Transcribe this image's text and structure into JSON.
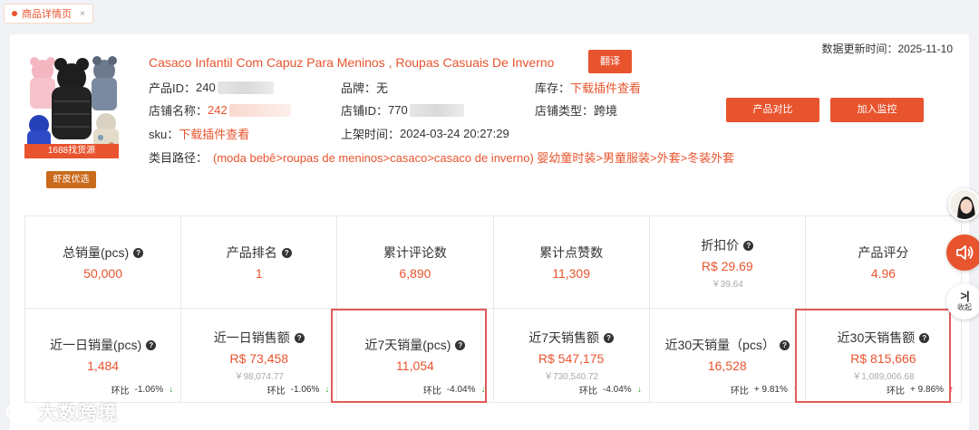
{
  "tab": {
    "label": "商品详情页",
    "close": "×"
  },
  "update_time": "数据更新时间：2025-11-10",
  "product": {
    "title": "Casaco Infantil Com Capuz Para Meninos , Roupas Casuais De Inverno",
    "translate_label": "翻译",
    "badge_1688": "1688找货源",
    "badge_shopee": "虾皮优选",
    "product_id_label": "产品ID：",
    "product_id_value": "240",
    "brand_label": "品牌：",
    "brand_value": "无",
    "stock_label": "库存：",
    "stock_value": "下载插件查看",
    "shop_name_label": "店铺名称：",
    "shop_name_value": "242",
    "shop_id_label": "店铺ID：",
    "shop_id_value": "770",
    "shop_type_label": "店铺类型：",
    "shop_type_value": "跨境",
    "sku_label": "sku：",
    "sku_value": "下载插件查看",
    "listed_label": "上架时间：",
    "listed_value": "2024-03-24 20:27:29",
    "category_label": "类目路径：",
    "category_value": "(moda bebê>roupas de meninos>casaco>casaco de inverno) 婴幼童时装>男童服装>外套>冬装外套"
  },
  "actions": {
    "compare_label": "产品对比",
    "monitor_label": "加入监控"
  },
  "stats_row1": [
    {
      "label": "总销量(pcs)",
      "help": true,
      "value": "50,000"
    },
    {
      "label": "产品排名",
      "help": true,
      "value": "1"
    },
    {
      "label": "累计评论数",
      "help": false,
      "value": "6,890"
    },
    {
      "label": "累计点赞数",
      "help": false,
      "value": "11,309"
    },
    {
      "label": "折扣价",
      "help": true,
      "value": "R$ 29.69",
      "sub": "￥39.64"
    },
    {
      "label": "产品评分",
      "help": false,
      "value": "4.96"
    }
  ],
  "stats_row2": [
    {
      "label": "近一日销量(pcs)",
      "value": "1,484",
      "ring_label": "环比",
      "ring_value": "-1.06%",
      "trend": "down"
    },
    {
      "label": "近一日销售额",
      "value": "R$ 73,458",
      "sub": "￥98,074.77",
      "ring_label": "环比",
      "ring_value": "-1.06%",
      "trend": "down"
    },
    {
      "label": "近7天销量(pcs)",
      "value": "11,054",
      "ring_label": "环比",
      "ring_value": "-4.04%",
      "trend": "down"
    },
    {
      "label": "近7天销售额",
      "value": "R$ 547,175",
      "sub": "￥730,540.72",
      "ring_label": "环比",
      "ring_value": "-4.04%",
      "trend": "down"
    },
    {
      "label": "近30天销量（pcs）",
      "value": "16,528",
      "ring_label": "环比",
      "ring_value": "+ 9.81%",
      "trend": "up"
    },
    {
      "label": "近30天销售额",
      "value": "R$ 815,666",
      "sub": "￥1,089,006.68",
      "ring_label": "环比",
      "ring_value": "+ 9.86%",
      "trend": "up"
    }
  ],
  "side": {
    "collapse_label": "收起"
  },
  "watermark": "大数跨境",
  "colors": {
    "accent": "#e8542e",
    "highlight": "#e35a5a",
    "down": "#3a9e3a",
    "up": "#e8252e"
  },
  "icons": {
    "help": "question-circle-icon",
    "down": "arrow-down-icon",
    "up": "arrow-up-icon",
    "speaker": "speaker-icon",
    "collapse": "collapse-icon"
  }
}
